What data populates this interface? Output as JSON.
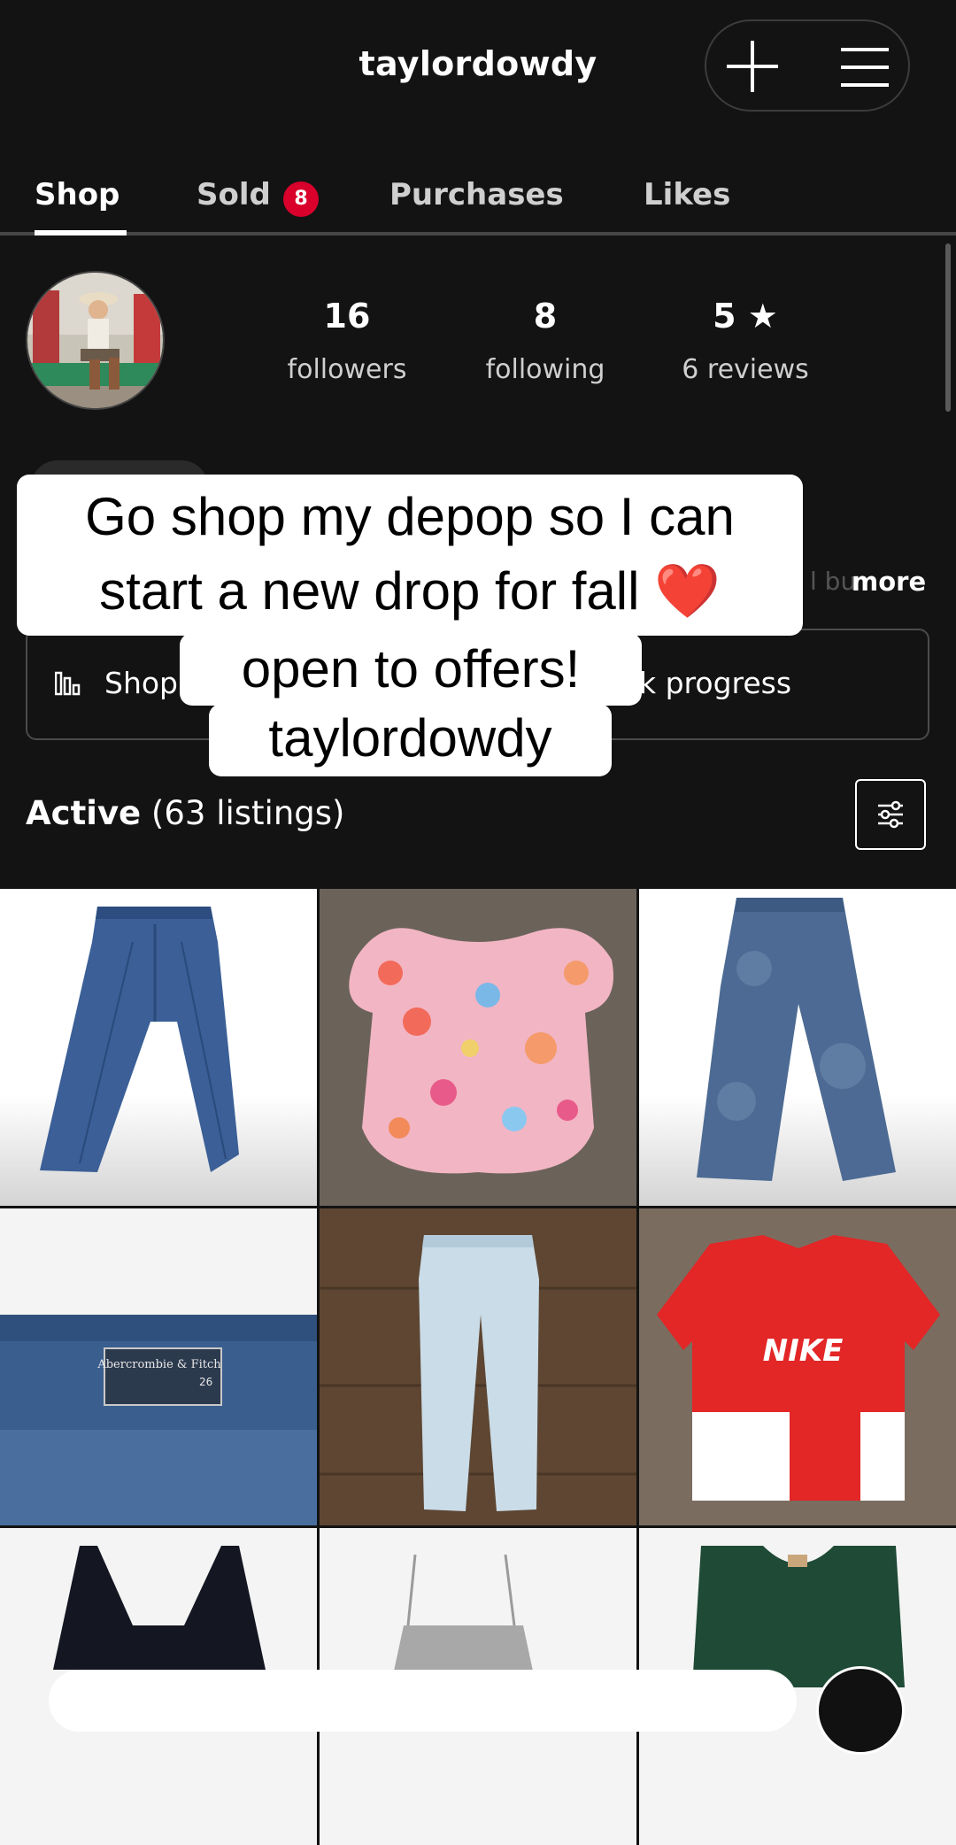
{
  "header": {
    "username": "taylordowdy",
    "add_icon": "plus-icon",
    "menu_icon": "hamburger-menu-icon"
  },
  "tabs": [
    {
      "label": "Shop",
      "active": true
    },
    {
      "label": "Sold",
      "badge": "8"
    },
    {
      "label": "Purchases"
    },
    {
      "label": "Likes"
    }
  ],
  "profile": {
    "followers_count": "16",
    "followers_label": "followers",
    "following_count": "8",
    "following_label": "following",
    "rating": "5 ★",
    "reviews_label": "6 reviews",
    "more_label": "more",
    "more_fade": "l bu"
  },
  "stats_button": {
    "left_label": "Shop",
    "right_label": "k progress",
    "icon": "bar-chart-icon"
  },
  "listings": {
    "status": "Active",
    "count_label": "(63 listings)",
    "filter_icon": "filter-sliders-icon",
    "items": [
      {
        "name": "flared-jeans"
      },
      {
        "name": "floral-blouse"
      },
      {
        "name": "acid-wash-jeans"
      },
      {
        "name": "abercrombie-jeans",
        "tag_text": "Abercrombie & Fitch",
        "tag_size": "26"
      },
      {
        "name": "light-wash-jeans"
      },
      {
        "name": "nike-shirt",
        "logo_text": "NIKE"
      },
      {
        "name": "black-sports-bra"
      },
      {
        "name": "lace-cami"
      },
      {
        "name": "green-tank"
      }
    ]
  },
  "caption": {
    "line1": "Go shop my depop so I can",
    "line2": "start a new drop for fall ❤️",
    "line3": "open to offers!",
    "line4": "taylordowdy"
  },
  "colors": {
    "background": "#131313",
    "badge": "#d9002b",
    "tab_divider": "#474747"
  }
}
